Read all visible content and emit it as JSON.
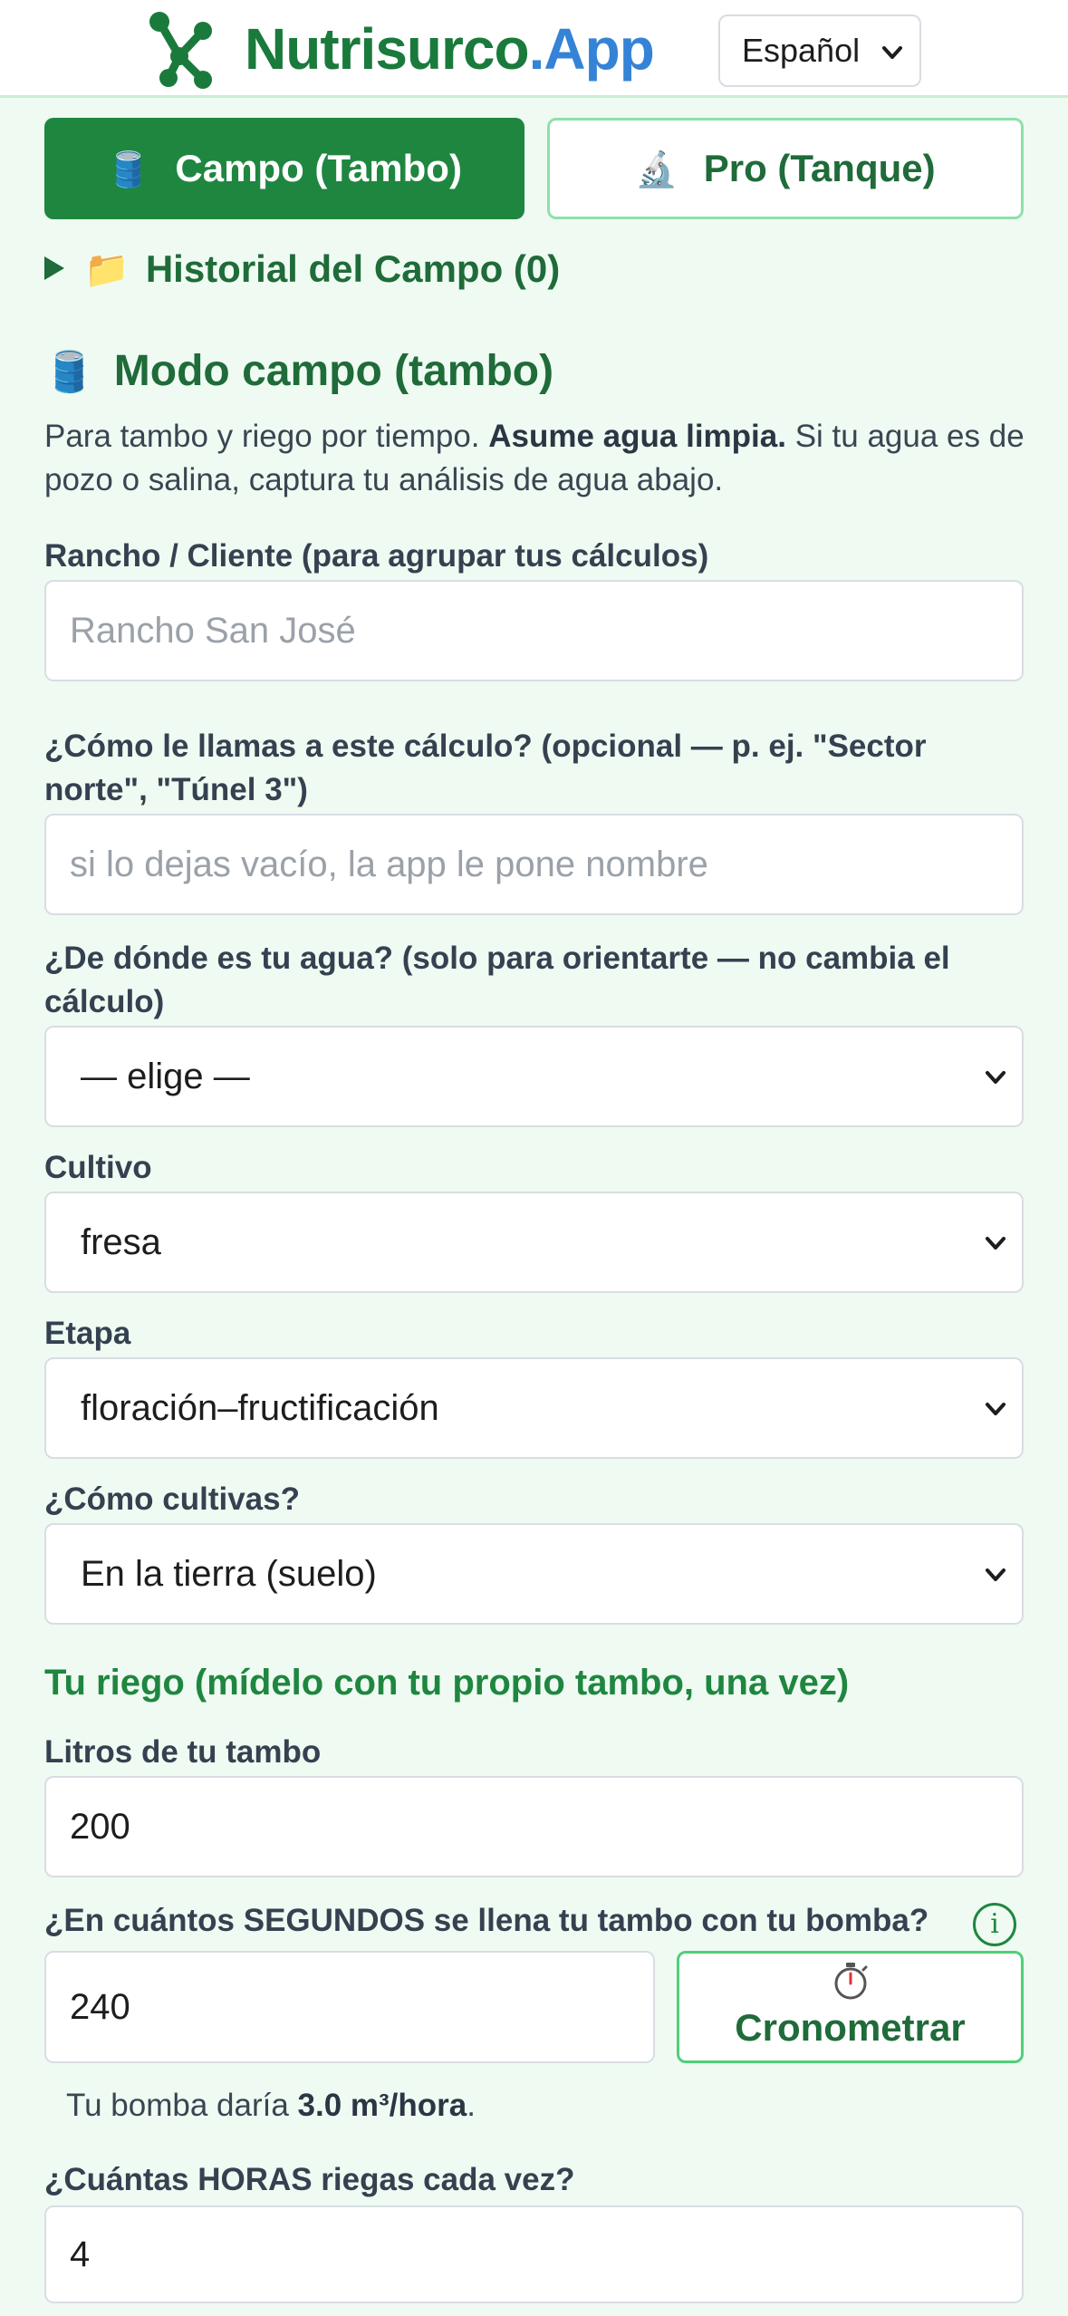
{
  "header": {
    "brand_part1": "Nutrisurco",
    "brand_part2": ".App",
    "language": "Español",
    "brand_color": "#1a7a3c",
    "accent_color": "#3583d6"
  },
  "tabs": [
    {
      "icon": "🛢️",
      "label": "Campo (Tambo)",
      "active": true
    },
    {
      "icon": "🔬",
      "label": "Pro (Tanque)",
      "active": false
    }
  ],
  "history": {
    "icon": "📁",
    "label": "Historial del Campo (0)"
  },
  "section": {
    "icon": "🛢️",
    "title": "Modo campo (tambo)",
    "intro_before": "Para tambo y riego por tiempo. ",
    "intro_bold": "Asume agua limpia.",
    "intro_after": " Si tu agua es de pozo o salina, captura tu análisis de agua abajo."
  },
  "form": {
    "ranch": {
      "label": "Rancho / Cliente (para agrupar tus cálculos)",
      "placeholder": "Rancho San José",
      "value": ""
    },
    "calc_name": {
      "label": "¿Cómo le llamas a este cálculo? (opcional — p. ej. \"Sector norte\", \"Túnel 3\")",
      "placeholder": "si lo dejas vacío, la app le pone nombre",
      "value": ""
    },
    "water_source": {
      "label": "¿De dónde es tu agua? (solo para orientarte — no cambia el cálculo)",
      "value": "— elige —"
    },
    "crop": {
      "label": "Cultivo",
      "value": "fresa"
    },
    "stage": {
      "label": "Etapa",
      "value": "floración–fructificación"
    },
    "growing": {
      "label": "¿Cómo cultivas?",
      "value": "En la tierra (suelo)"
    }
  },
  "irrigation": {
    "heading": "Tu riego (mídelo con tu propio tambo, una vez)",
    "liters": {
      "label": "Litros de tu tambo",
      "value": "200"
    },
    "seconds": {
      "label": "¿En cuántos SEGUNDOS se llena tu tambo con tu bomba?",
      "value": "240",
      "info": "i"
    },
    "stopwatch": {
      "icon": "⏱️",
      "label": "Cronometrar"
    },
    "pump_before": "Tu bomba daría ",
    "pump_bold": "3.0 m³/hora",
    "pump_after": ".",
    "hours": {
      "label": "¿Cuántas HORAS riegas cada vez?",
      "value": "4"
    }
  }
}
